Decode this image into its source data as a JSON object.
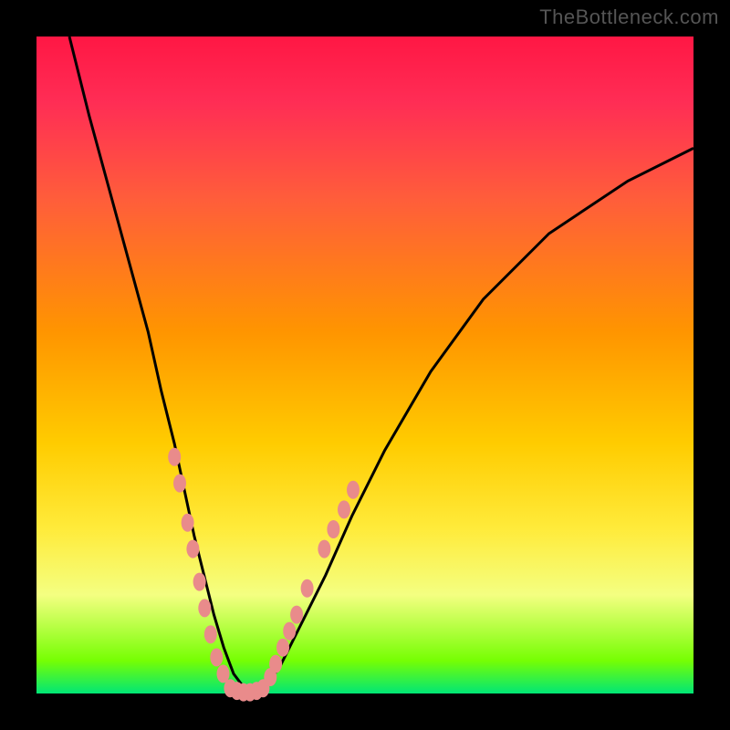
{
  "watermark": "TheBottleneck.com",
  "chart_data": {
    "type": "line",
    "title": "",
    "xlabel": "",
    "ylabel": "",
    "xlim": [
      0,
      100
    ],
    "ylim": [
      0,
      100
    ],
    "grid": false,
    "series": [
      {
        "name": "bottleneck-curve",
        "x": [
          5,
          8,
          11,
          14,
          17,
          19,
          21,
          22.5,
          24,
          25.5,
          27,
          28.5,
          30,
          31.5,
          33,
          34,
          37,
          40,
          44,
          48,
          53,
          60,
          68,
          78,
          90,
          100
        ],
        "values": [
          100,
          88,
          77,
          66,
          55,
          46,
          38,
          31,
          24,
          18,
          12,
          7,
          3,
          1,
          0,
          0,
          4,
          10,
          18,
          27,
          37,
          49,
          60,
          70,
          78,
          83
        ]
      }
    ],
    "markers_left": [
      {
        "x": 21.0,
        "y": 36
      },
      {
        "x": 21.8,
        "y": 32
      },
      {
        "x": 23.0,
        "y": 26
      },
      {
        "x": 23.8,
        "y": 22
      },
      {
        "x": 24.8,
        "y": 17
      },
      {
        "x": 25.6,
        "y": 13
      },
      {
        "x": 26.5,
        "y": 9
      },
      {
        "x": 27.4,
        "y": 5.5
      },
      {
        "x": 28.4,
        "y": 3
      }
    ],
    "markers_bottom": [
      {
        "x": 29.5,
        "y": 0.8
      },
      {
        "x": 30.5,
        "y": 0.4
      },
      {
        "x": 31.5,
        "y": 0.2
      },
      {
        "x": 32.5,
        "y": 0.2
      },
      {
        "x": 33.5,
        "y": 0.4
      },
      {
        "x": 34.5,
        "y": 0.8
      }
    ],
    "markers_right": [
      {
        "x": 35.6,
        "y": 2.5
      },
      {
        "x": 36.4,
        "y": 4.5
      },
      {
        "x": 37.5,
        "y": 7
      },
      {
        "x": 38.5,
        "y": 9.5
      },
      {
        "x": 39.6,
        "y": 12
      },
      {
        "x": 41.2,
        "y": 16
      },
      {
        "x": 43.8,
        "y": 22
      },
      {
        "x": 45.2,
        "y": 25
      },
      {
        "x": 46.8,
        "y": 28
      },
      {
        "x": 48.2,
        "y": 31
      }
    ],
    "marker_color": "#e98b8b",
    "curve_color": "#000000"
  }
}
